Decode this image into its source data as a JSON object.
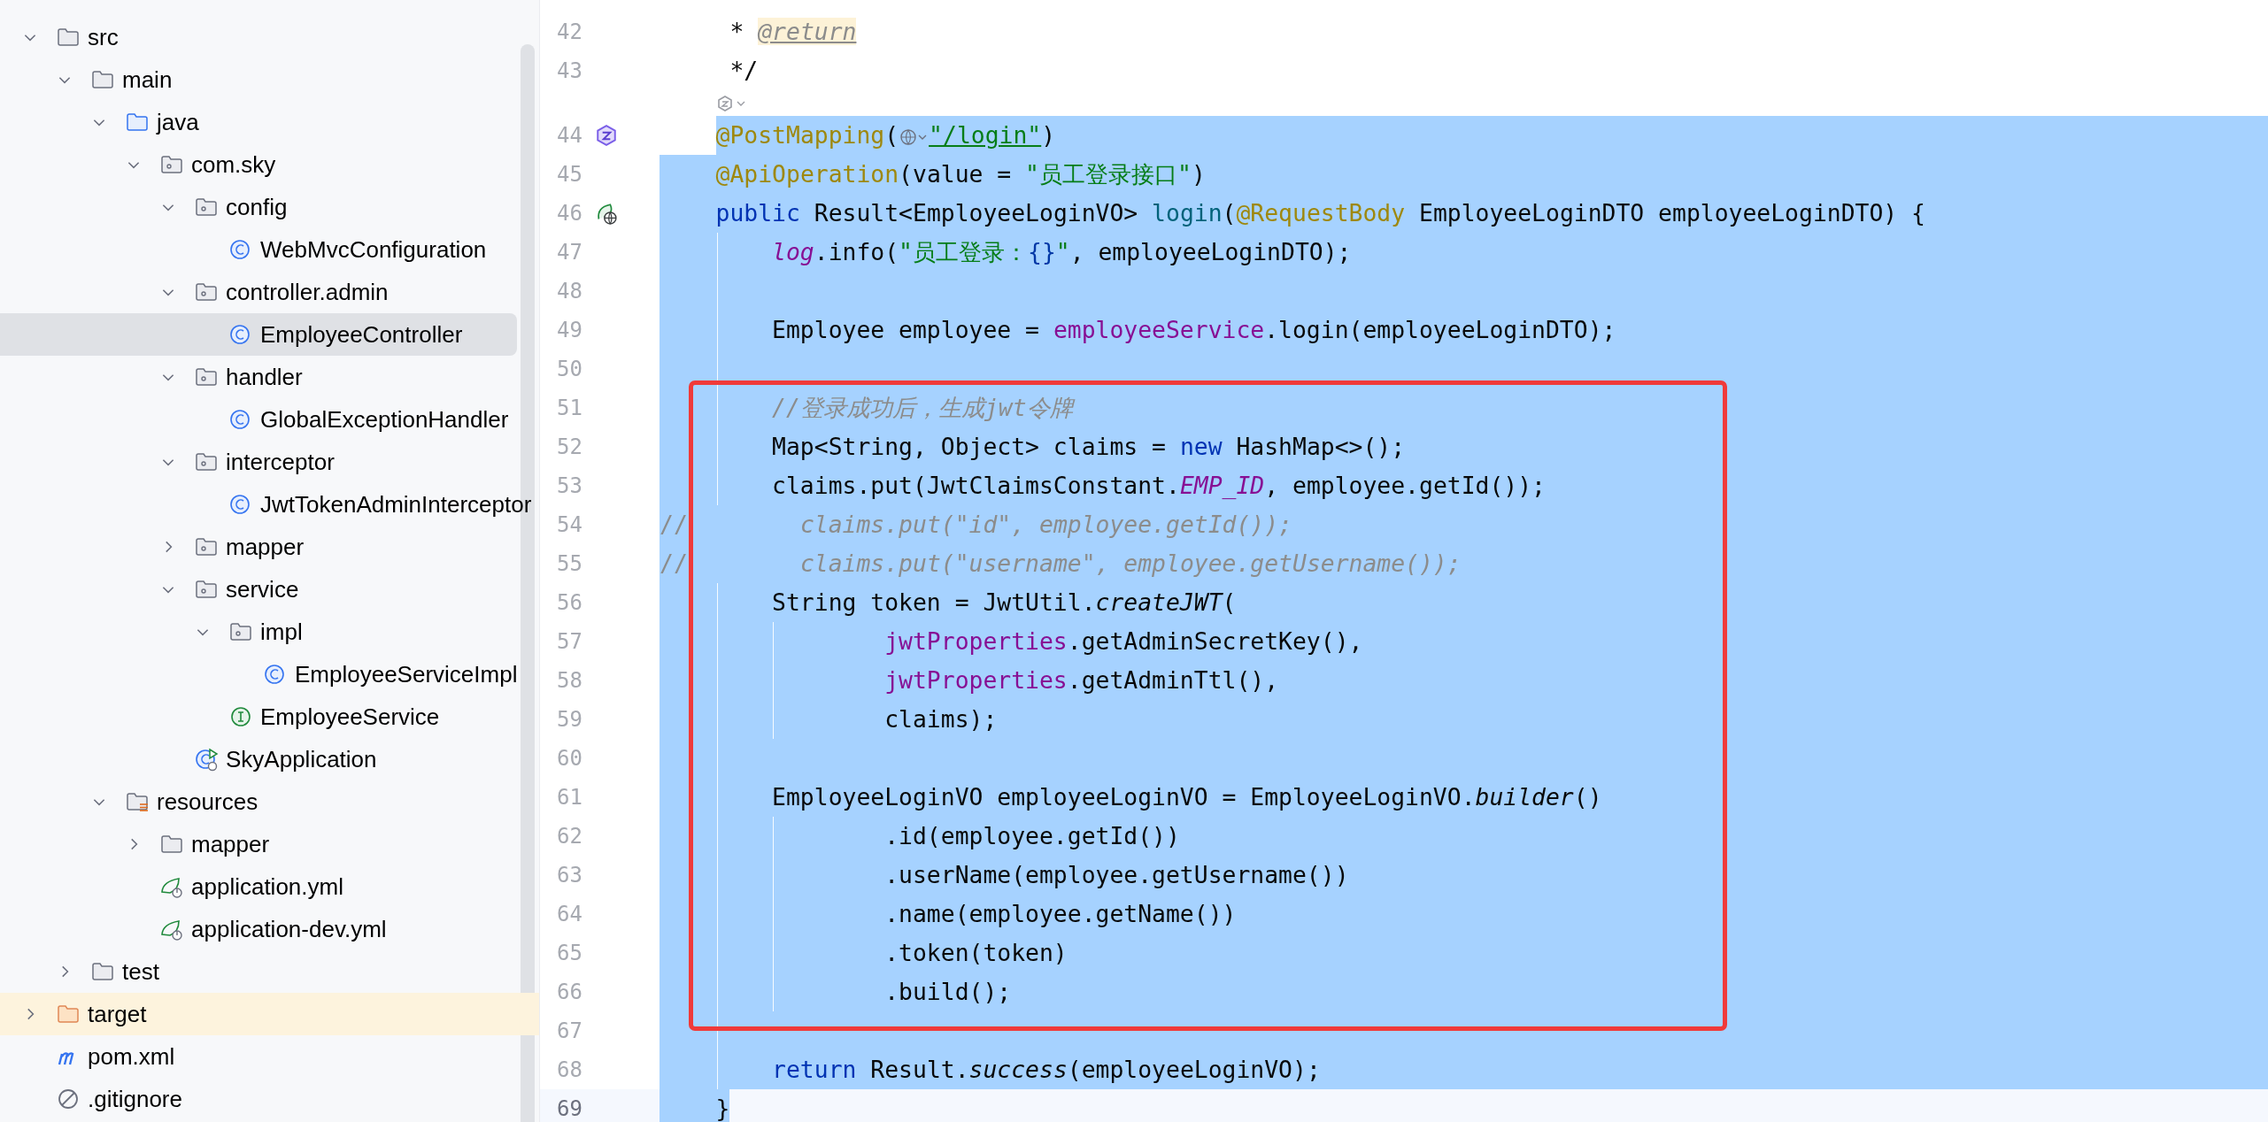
{
  "project_tree": [
    {
      "label": "src",
      "kind": "folder",
      "selected": false,
      "expanded": true,
      "children": [
        {
          "label": "main",
          "kind": "folder",
          "selected": false,
          "expanded": true,
          "children": [
            {
              "label": "java",
              "kind": "source-folder",
              "selected": false,
              "expanded": true,
              "children": [
                {
                  "label": "com.sky",
                  "kind": "package",
                  "selected": false,
                  "expanded": true,
                  "children": [
                    {
                      "label": "config",
                      "kind": "package",
                      "selected": false,
                      "expanded": true,
                      "children": [
                        {
                          "label": "WebMvcConfiguration",
                          "kind": "class",
                          "selected": false
                        }
                      ]
                    },
                    {
                      "label": "controller.admin",
                      "kind": "package",
                      "selected": false,
                      "expanded": true,
                      "children": [
                        {
                          "label": "EmployeeController",
                          "kind": "class",
                          "selected": true
                        }
                      ]
                    },
                    {
                      "label": "handler",
                      "kind": "package",
                      "selected": false,
                      "expanded": true,
                      "children": [
                        {
                          "label": "GlobalExceptionHandler",
                          "kind": "class",
                          "selected": false
                        }
                      ]
                    },
                    {
                      "label": "interceptor",
                      "kind": "package",
                      "selected": false,
                      "expanded": true,
                      "children": [
                        {
                          "label": "JwtTokenAdminInterceptor",
                          "kind": "class",
                          "selected": false
                        }
                      ]
                    },
                    {
                      "label": "mapper",
                      "kind": "package",
                      "selected": false,
                      "expanded": false
                    },
                    {
                      "label": "service",
                      "kind": "package",
                      "selected": false,
                      "expanded": true,
                      "children": [
                        {
                          "label": "impl",
                          "kind": "package",
                          "selected": false,
                          "expanded": true,
                          "children": [
                            {
                              "label": "EmployeeServiceImpl",
                              "kind": "class",
                              "selected": false
                            }
                          ]
                        },
                        {
                          "label": "EmployeeService",
                          "kind": "interface",
                          "selected": false
                        }
                      ]
                    },
                    {
                      "label": "SkyApplication",
                      "kind": "app-class",
                      "selected": false
                    }
                  ]
                }
              ]
            },
            {
              "label": "resources",
              "kind": "resources-folder",
              "selected": false,
              "expanded": true,
              "children": [
                {
                  "label": "mapper",
                  "kind": "folder",
                  "selected": false,
                  "expanded": false
                },
                {
                  "label": "application.yml",
                  "kind": "yml",
                  "selected": false
                },
                {
                  "label": "application-dev.yml",
                  "kind": "yml",
                  "selected": false
                }
              ]
            }
          ]
        },
        {
          "label": "test",
          "kind": "folder",
          "selected": false,
          "expanded": false
        }
      ]
    },
    {
      "label": "target",
      "kind": "excluded-folder",
      "selected": false,
      "expanded": false
    },
    {
      "label": "pom.xml",
      "kind": "maven",
      "selected": false
    },
    {
      "label": ".gitignore",
      "kind": "ignore",
      "selected": false
    }
  ],
  "editor": {
    "lines": [
      {
        "kind": "code",
        "number": "42",
        "selected": false,
        "current": false,
        "tokens": [
          {
            "kind": "plain",
            "text": "     * "
          },
          {
            "kind": "doc-tag",
            "text": "@return"
          }
        ]
      },
      {
        "kind": "code",
        "number": "43",
        "selected": false,
        "current": false,
        "tokens": [
          {
            "kind": "plain",
            "text": "     */"
          }
        ]
      },
      {
        "kind": "hint",
        "selected": false
      },
      {
        "kind": "code",
        "number": "44",
        "selected": true,
        "partial": true,
        "current": false,
        "gutter_icon": {
          "kind": "spring"
        },
        "tokens": [
          {
            "kind": "annotation",
            "text": "    @PostMapping"
          },
          {
            "kind": "plain",
            "text": "("
          },
          {
            "kind": "globe-inlay"
          },
          {
            "kind": "url",
            "text": "\"/login\""
          },
          {
            "kind": "plain",
            "text": ")"
          }
        ]
      },
      {
        "kind": "code",
        "number": "45",
        "selected": true,
        "partial": false,
        "current": false,
        "tokens": [
          {
            "kind": "annotation",
            "text": "    @ApiOperation"
          },
          {
            "kind": "plain",
            "text": "(value = "
          },
          {
            "kind": "string",
            "text": "\"员工登录接口\""
          },
          {
            "kind": "plain",
            "text": ")"
          }
        ]
      },
      {
        "kind": "code",
        "number": "46",
        "selected": true,
        "partial": false,
        "current": false,
        "gutter_icon": {
          "kind": "web"
        },
        "tokens": [
          {
            "kind": "keyword",
            "text": "    public"
          },
          {
            "kind": "plain",
            "text": " Result<EmployeeLoginVO> "
          },
          {
            "kind": "decl",
            "text": "login"
          },
          {
            "kind": "plain",
            "text": "("
          },
          {
            "kind": "annotation",
            "text": "@RequestBody"
          },
          {
            "kind": "plain",
            "text": " EmployeeLoginDTO employeeLoginDTO) {"
          }
        ]
      },
      {
        "kind": "code",
        "number": "47",
        "selected": true,
        "partial": false,
        "current": false,
        "tokens": [
          {
            "kind": "static-field",
            "text": "        log"
          },
          {
            "kind": "plain",
            "text": ".info("
          },
          {
            "kind": "string",
            "text": "\"员工登录："
          },
          {
            "kind": "format",
            "text": "{}"
          },
          {
            "kind": "string",
            "text": "\""
          },
          {
            "kind": "plain",
            "text": ", employeeLoginDTO);"
          }
        ]
      },
      {
        "kind": "blank",
        "number": "48",
        "selected": true,
        "partial": false,
        "current": false
      },
      {
        "kind": "code",
        "number": "49",
        "selected": true,
        "partial": false,
        "current": false,
        "tokens": [
          {
            "kind": "plain",
            "text": "        Employee employee = "
          },
          {
            "kind": "field",
            "text": "employeeService"
          },
          {
            "kind": "plain",
            "text": ".login(employeeLoginDTO);"
          }
        ]
      },
      {
        "kind": "blank",
        "number": "50",
        "selected": true,
        "partial": false,
        "current": false
      },
      {
        "kind": "code",
        "number": "51",
        "selected": true,
        "partial": false,
        "current": false,
        "tokens": [
          {
            "kind": "comment",
            "text": "        //登录成功后，生成jwt令牌"
          }
        ]
      },
      {
        "kind": "code",
        "number": "52",
        "selected": true,
        "partial": false,
        "current": false,
        "tokens": [
          {
            "kind": "plain",
            "text": "        Map<String, Object> claims = "
          },
          {
            "kind": "keyword",
            "text": "new"
          },
          {
            "kind": "plain",
            "text": " HashMap<>();"
          }
        ]
      },
      {
        "kind": "code",
        "number": "53",
        "selected": true,
        "partial": false,
        "current": false,
        "tokens": [
          {
            "kind": "plain",
            "text": "        claims.put(JwtClaimsConstant."
          },
          {
            "kind": "static-field",
            "text": "EMP_ID"
          },
          {
            "kind": "plain",
            "text": ", employee.getId());"
          }
        ]
      },
      {
        "kind": "code",
        "number": "54",
        "selected": true,
        "partial": false,
        "current": false,
        "tokens": [
          {
            "kind": "comment-mark",
            "text": "//"
          },
          {
            "kind": "comment",
            "text": "        claims.put(\"id\", employee.getId());"
          }
        ]
      },
      {
        "kind": "code",
        "number": "55",
        "selected": true,
        "partial": false,
        "current": false,
        "tokens": [
          {
            "kind": "comment-mark",
            "text": "//"
          },
          {
            "kind": "comment",
            "text": "        claims.put(\"username\", employee.getUsername());"
          }
        ]
      },
      {
        "kind": "code",
        "number": "56",
        "selected": true,
        "partial": false,
        "current": false,
        "tokens": [
          {
            "kind": "plain",
            "text": "        String token = JwtUtil."
          },
          {
            "kind": "static",
            "text": "createJWT"
          },
          {
            "kind": "plain",
            "text": "("
          }
        ]
      },
      {
        "kind": "code",
        "number": "57",
        "selected": true,
        "partial": false,
        "current": false,
        "tokens": [
          {
            "kind": "field",
            "text": "                jwtProperties"
          },
          {
            "kind": "plain",
            "text": ".getAdminSecretKey(),"
          }
        ]
      },
      {
        "kind": "code",
        "number": "58",
        "selected": true,
        "partial": false,
        "current": false,
        "tokens": [
          {
            "kind": "field",
            "text": "                jwtProperties"
          },
          {
            "kind": "plain",
            "text": ".getAdminTtl(),"
          }
        ]
      },
      {
        "kind": "code",
        "number": "59",
        "selected": true,
        "partial": false,
        "current": false,
        "tokens": [
          {
            "kind": "plain",
            "text": "                claims);"
          }
        ]
      },
      {
        "kind": "blank",
        "number": "60",
        "selected": true,
        "partial": false,
        "current": false
      },
      {
        "kind": "code",
        "number": "61",
        "selected": true,
        "partial": false,
        "current": false,
        "tokens": [
          {
            "kind": "plain",
            "text": "        EmployeeLoginVO employeeLoginVO = EmployeeLoginVO."
          },
          {
            "kind": "static",
            "text": "builder"
          },
          {
            "kind": "plain",
            "text": "()"
          }
        ]
      },
      {
        "kind": "code",
        "number": "62",
        "selected": true,
        "partial": false,
        "current": false,
        "tokens": [
          {
            "kind": "plain",
            "text": "                .id(employee.getId())"
          }
        ]
      },
      {
        "kind": "code",
        "number": "63",
        "selected": true,
        "partial": false,
        "current": false,
        "tokens": [
          {
            "kind": "plain",
            "text": "                .userName(employee.getUsername())"
          }
        ]
      },
      {
        "kind": "code",
        "number": "64",
        "selected": true,
        "partial": false,
        "current": false,
        "tokens": [
          {
            "kind": "plain",
            "text": "                .name(employee.getName())"
          }
        ]
      },
      {
        "kind": "code",
        "number": "65",
        "selected": true,
        "partial": false,
        "current": false,
        "tokens": [
          {
            "kind": "plain",
            "text": "                .token(token)"
          }
        ]
      },
      {
        "kind": "code",
        "number": "66",
        "selected": true,
        "partial": false,
        "current": false,
        "tokens": [
          {
            "kind": "plain",
            "text": "                .build();"
          }
        ]
      },
      {
        "kind": "blank",
        "number": "67",
        "selected": true,
        "partial": false,
        "current": false
      },
      {
        "kind": "code",
        "number": "68",
        "selected": true,
        "partial": false,
        "current": false,
        "tokens": [
          {
            "kind": "keyword",
            "text": "        return"
          },
          {
            "kind": "plain",
            "text": " Result."
          },
          {
            "kind": "static",
            "text": "success"
          },
          {
            "kind": "plain",
            "text": "(employeeLoginVO);"
          }
        ]
      },
      {
        "kind": "code",
        "number": "69",
        "selected": true,
        "partial": true,
        "current": true,
        "tokens": [
          {
            "kind": "plain",
            "text": "    }"
          }
        ]
      }
    ]
  }
}
